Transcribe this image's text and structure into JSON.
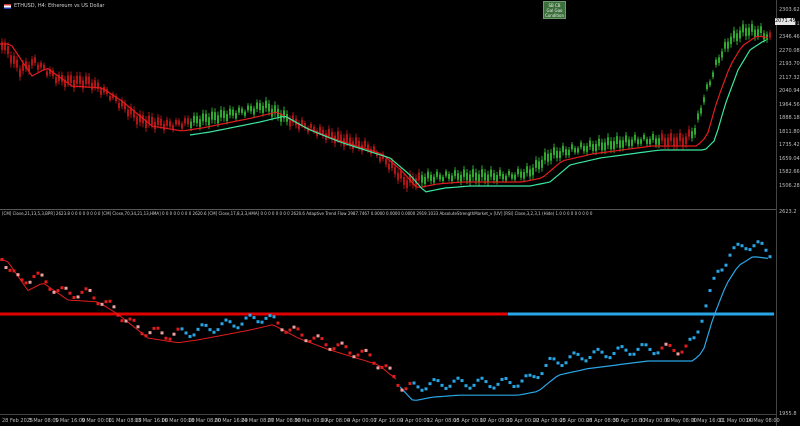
{
  "symbol": {
    "title": "ETHUSD, H4:  Ethereum vs US Dollar"
  },
  "buttons": {
    "line1": "SB  CB",
    "line2": "Gal   Gao",
    "line3": "Condition"
  },
  "price_axis": {
    "labels": [
      "2303.625",
      "2027.815",
      "2346.465",
      "2270.085",
      "2193.705",
      "2117.325",
      "2040.945",
      "1964.565",
      "1888.185",
      "1811.805",
      "1735.425",
      "1659.045",
      "1582.665",
      "1506.285"
    ],
    "current": "2071.455"
  },
  "indicator": {
    "caption": "[CM] Close,21,13,5,3,BPR] 2623.8 0 0 0 0 0 0 0 0  [CM] Close,70,34,21,13,HMA] 0 0 0 0 0 0 0 0 2620.6  [CM] Close,17,8,3,3,HMA] 0 0 0 0 0 0 0 0 2620.6  Adaptive Trend Flow 2987.7467 0.0000 0.0000 0.0000 2919.1033  AbsoluteStrengthMarket_v [UV] [RSI] Close,3,2,3,1 (Hide) 1.0 0 0 0 0 0 0 0 0",
    "axis_top": "2623.2",
    "axis_bottom": "1955.8",
    "level": 1770
  },
  "time_axis": {
    "labels": [
      "28 Feb 2025",
      "3 Mar 08:00",
      "5 Mar 16:00",
      "9 Mar 00:00",
      "11 Mar 08:00",
      "13 Mar 16:00",
      "16 Mar 00:00",
      "18 Mar 08:00",
      "20 Mar 16:00",
      "24 Mar 08:00",
      "27 Mar 08:00",
      "30 Mar 00:00",
      "1 Apr 08:00",
      "4 Apr 00:00",
      "7 Apr 16:00",
      "9 Apr 00:00",
      "12 Apr 08:00",
      "15 Apr 00:00",
      "17 Apr 08:00",
      "20 Apr 00:00",
      "22 Apr 08:00",
      "25 Apr 00:00",
      "28 Apr 08:00",
      "30 Apr 16:00",
      "3 May 00:00",
      "6 May 08:00",
      "8 May 16:00",
      "11 May 00:00",
      "14 May 08:00"
    ]
  },
  "colors": {
    "bull": "#2ea82e",
    "bear": "#b01414",
    "trend_up": "#3ce6a0",
    "trend_down": "#e01e1e",
    "blue": "#2aa6e6",
    "level_red": "#e00000",
    "level_blue": "#2aa6e6"
  }
}
